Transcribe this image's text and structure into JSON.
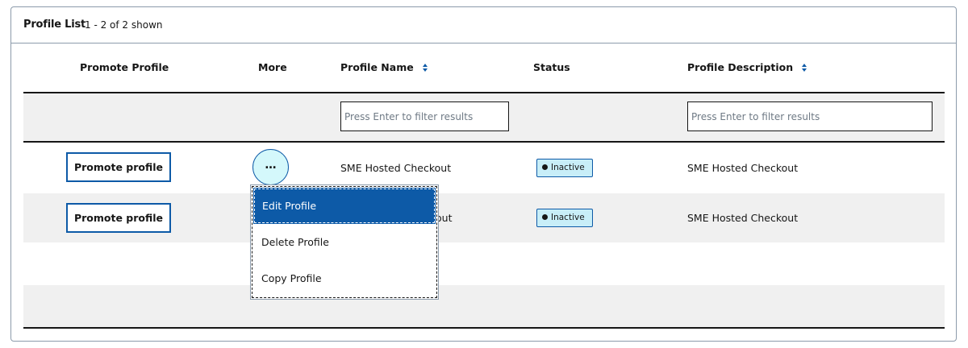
{
  "panel": {
    "title": "Profile List",
    "count": "1 - 2 of 2 shown"
  },
  "columns": {
    "promote": "Promote Profile",
    "more": "More",
    "name": "Profile Name",
    "status": "Status",
    "description": "Profile Description"
  },
  "filters": {
    "name_placeholder": "Press Enter to filter results",
    "description_placeholder": "Press Enter to filter results"
  },
  "rows": [
    {
      "promote_label": "Promote profile",
      "more_label": "…",
      "name": "SME Hosted Checkout",
      "status": "Inactive",
      "description": "SME Hosted Checkout"
    },
    {
      "promote_label": "Promote profile",
      "name_visible_part": "out",
      "name": "SME Hosted Checkout",
      "status": "Inactive",
      "description": "SME Hosted Checkout"
    }
  ],
  "more_menu": {
    "items": [
      "Edit Profile",
      "Delete Profile",
      "Copy Profile"
    ],
    "active_index": 0
  },
  "colors": {
    "accent": "#0d5aa7",
    "badge_bg": "#c8eef8",
    "more_button_bg": "#d4f8fb",
    "row_stripe": "#f0f0f0"
  },
  "icons": {
    "sort": "sort-icon",
    "more": "ellipsis-icon",
    "status": "status-dot-icon"
  }
}
